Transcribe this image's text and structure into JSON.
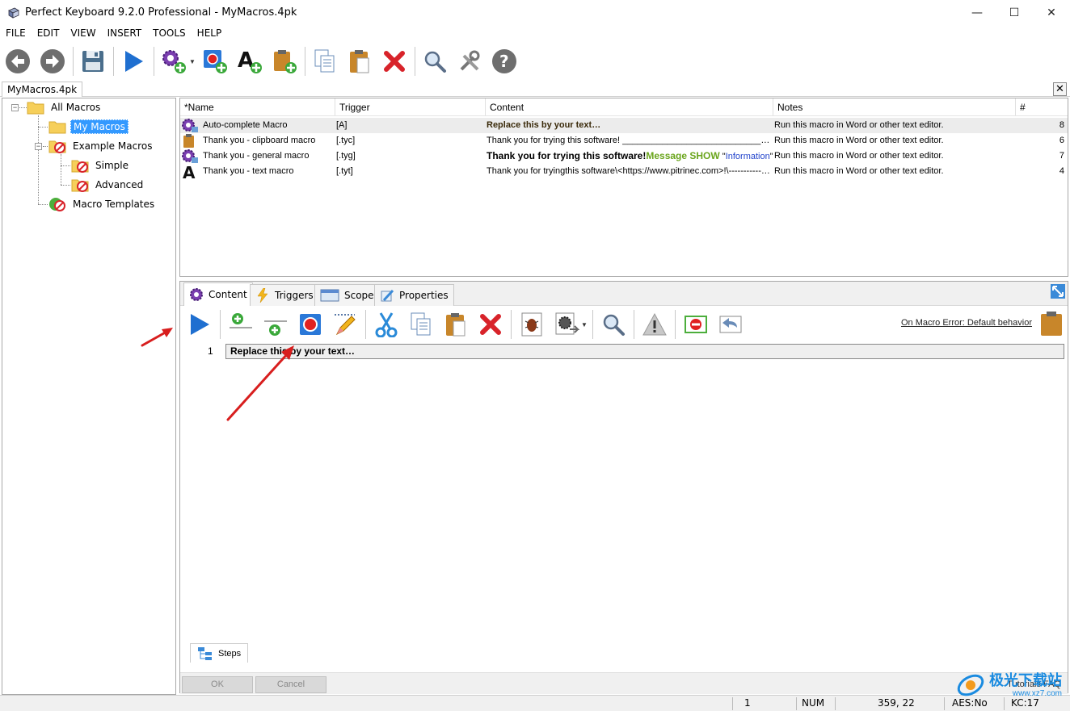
{
  "window": {
    "title": "Perfect Keyboard 9.2.0 Professional - MyMacros.4pk",
    "minimize": "—",
    "maximize": "☐",
    "close": "✕"
  },
  "menu": [
    "FILE",
    "EDIT",
    "VIEW",
    "INSERT",
    "TOOLS",
    "HELP"
  ],
  "toolbar": {
    "icons": [
      "back-icon",
      "forward-icon",
      "save-icon",
      "run-icon",
      "new-macro-icon",
      "record-macro-icon",
      "new-text-macro-icon",
      "new-clipboard-macro-icon",
      "copy-icon",
      "paste-icon",
      "delete-icon",
      "find-icon",
      "tools-icon",
      "help-icon"
    ]
  },
  "document_tab": {
    "label": "MyMacros.4pk",
    "close": "✕"
  },
  "tree": {
    "all_macros": "All Macros",
    "my_macros": "My Macros",
    "example_macros": "Example Macros",
    "simple": "Simple",
    "advanced": "Advanced",
    "macro_templates": "Macro Templates",
    "expand_collapse": "−"
  },
  "list": {
    "headers": [
      "*Name",
      "Trigger",
      "Content",
      "Notes",
      "#"
    ],
    "rows": [
      {
        "name": "Auto-complete Macro",
        "trigger": "[A]",
        "content": "Replace this by your text…",
        "notes": "Run this macro in Word or other text editor.",
        "count": "8"
      },
      {
        "name": "Thank you - clipboard macro",
        "trigger": "[.tyc]",
        "content": "Thank you for trying this software! ____________________________…",
        "notes": "Run this macro in Word or other text editor.",
        "count": "6"
      },
      {
        "name": "Thank you - general macro",
        "trigger": "[.tyg]",
        "content_bold": "Thank you for trying this software!",
        "content_green": "Message SHOW",
        "content_quote1": " \"",
        "content_blue": "Information",
        "content_quote2": "\" :",
        "notes": "Run this macro in Word or other text editor.",
        "count": "7"
      },
      {
        "name": "Thank you - text macro",
        "trigger": "[.tyt]",
        "content": "Thank you for tryingthis software\\<https://www.pitrinec.com>!\\-----------…",
        "notes": "Run this macro in Word or other text editor.",
        "count": "4"
      }
    ]
  },
  "editor": {
    "tabs": [
      "Content",
      "Triggers",
      "Scope",
      "Properties"
    ],
    "on_error": "On Macro Error: Default behavior",
    "line_number": "1",
    "step_text": "Replace this by your text…",
    "steps_tab": "Steps",
    "ok": "OK",
    "cancel": "Cancel",
    "tutorials": "Tutorials  FAQ"
  },
  "statusbar": {
    "line": "1",
    "num": "NUM",
    "coords": "359,  22",
    "aes": "AES:No",
    "kc": "KC:17"
  },
  "watermark": {
    "text": "极光下载站",
    "sub": "www.xz7.com"
  },
  "colors": {
    "accent": "#3399ff",
    "run_blue": "#1f6fd0",
    "delete_red": "#d8232a",
    "green_text": "#6aa51c",
    "blue_text": "#2244cc",
    "annotation_arrow": "#d81e1e"
  }
}
